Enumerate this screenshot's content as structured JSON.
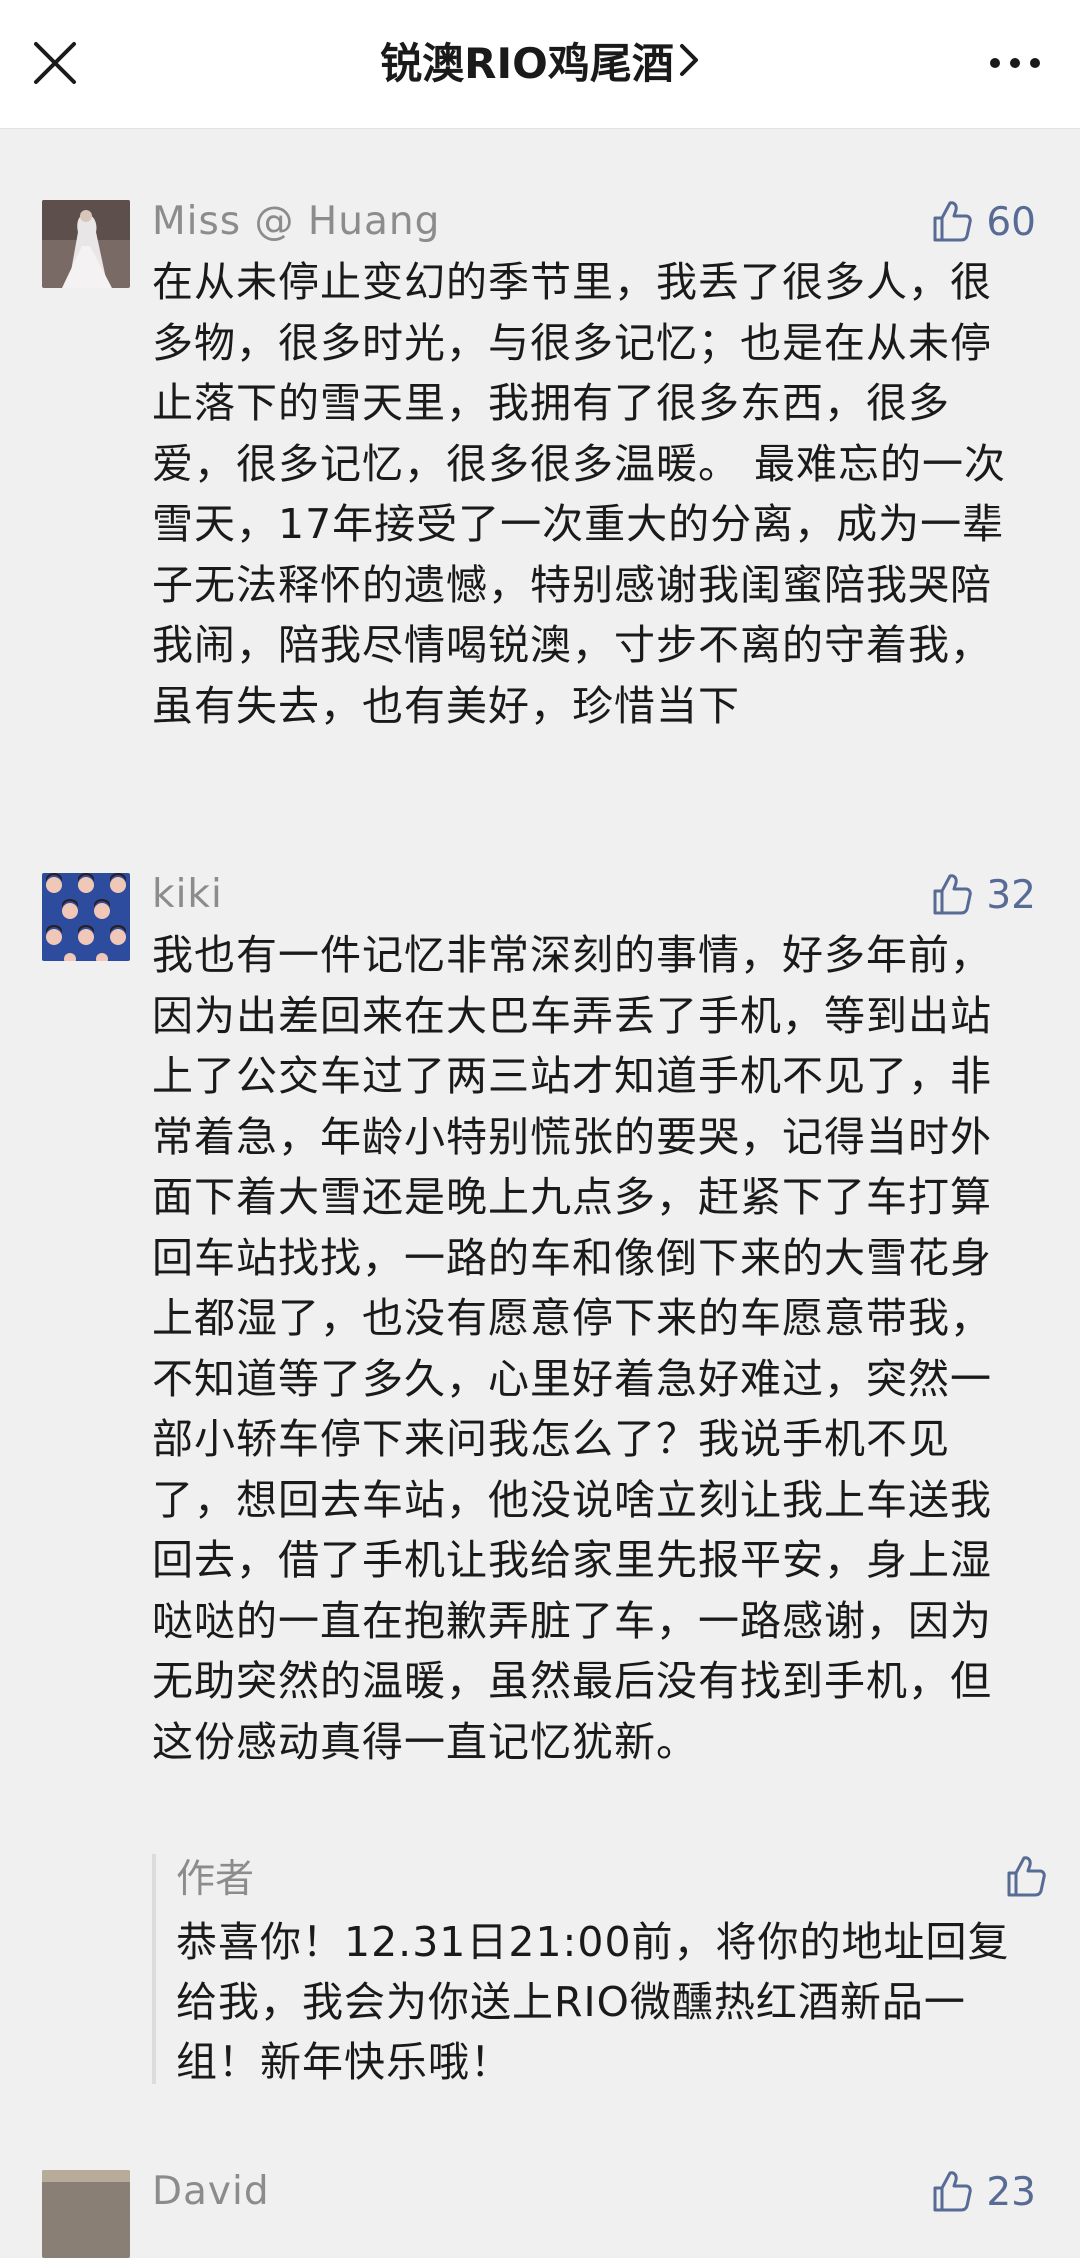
{
  "header": {
    "title": "锐澳RIO鸡尾酒",
    "close_icon": "close-icon",
    "more_icon": "more-dots-icon",
    "chevron_icon": "chevron-right-icon"
  },
  "colors": {
    "like_blue": "#576b95",
    "nickname_gray": "#8c8c8c",
    "text": "#1a1a1a",
    "background": "#f0f0f0"
  },
  "comments": [
    {
      "nickname": "Miss @ Huang",
      "likes": "60",
      "text": "在从未停止变幻的季节里，我丢了很多人，很多物，很多时光，与很多记忆；也是在从未停止落下的雪天里，我拥有了很多东西，很多爱，很多记忆，很多很多温暖。 最难忘的一次雪天，17年接受了一次重大的分离，成为一辈子无法释怀的遗憾，特别感谢我闺蜜陪我哭陪我闹，陪我尽情喝锐澳，寸步不离的守着我，虽有失去，也有美好，珍惜当下"
    },
    {
      "nickname": "kiki",
      "likes": "32",
      "text": "我也有一件记忆非常深刻的事情，好多年前，因为出差回来在大巴车弄丢了手机，等到出站上了公交车过了两三站才知道手机不见了，非常着急，年龄小特别慌张的要哭，记得当时外面下着大雪还是晚上九点多，赶紧下了车打算回车站找找，一路的车和像倒下来的大雪花身上都湿了，也没有愿意停下来的车愿意带我，不知道等了多久，心里好着急好难过，突然一部小轿车停下来问我怎么了？我说手机不见了，想回去车站，他没说啥立刻让我上车送我回去，借了手机让我给家里先报平安，身上湿哒哒的一直在抱歉弄脏了车，一路感谢，因为无助突然的温暖，虽然最后没有找到手机，但这份感动真得一直记忆犹新。",
      "reply": {
        "author": "作者",
        "text": "恭喜你！12.31日21:00前，将你的地址回复给我，我会为你送上RIO微醺热红酒新品一组！新年快乐哦！"
      }
    },
    {
      "nickname": "David",
      "likes": "23"
    }
  ]
}
